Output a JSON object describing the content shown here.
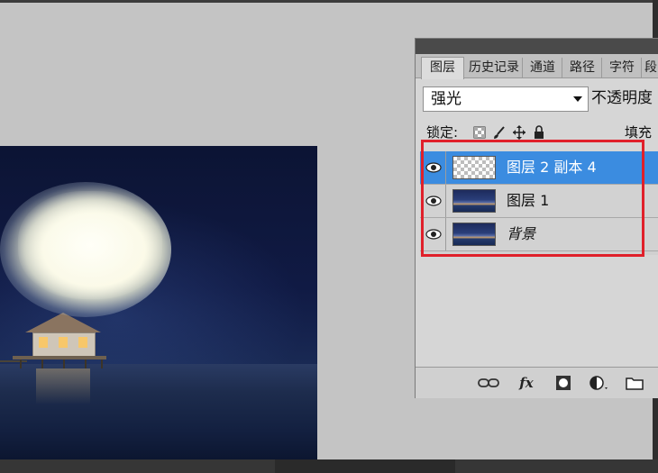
{
  "panel": {
    "tabs": [
      {
        "label": "图层",
        "active": true
      },
      {
        "label": "历史记录",
        "active": false
      },
      {
        "label": "通道",
        "active": false
      },
      {
        "label": "路径",
        "active": false
      },
      {
        "label": "字符",
        "active": false
      },
      {
        "label": "段",
        "active": false
      }
    ],
    "blend_mode": "强光",
    "opacity_label": "不透明度",
    "lock_label": "锁定:",
    "fill_label": "填充",
    "layers": [
      {
        "name": "图层 2 副本 4",
        "thumbnail": "transparent",
        "selected": true,
        "visible": true
      },
      {
        "name": "图层 1",
        "thumbnail": "photo",
        "selected": false,
        "visible": true
      },
      {
        "name": "背景",
        "thumbnail": "photo",
        "selected": false,
        "visible": true,
        "italic": true
      }
    ],
    "bottom_icons": [
      "link-icon",
      "fx-icon",
      "mask-icon",
      "adjustment-icon",
      "new-group-icon"
    ]
  },
  "colors": {
    "selection": "#3b8ce0",
    "highlight_box": "#e0202a",
    "canvas_bg": "#c4c4c4"
  }
}
